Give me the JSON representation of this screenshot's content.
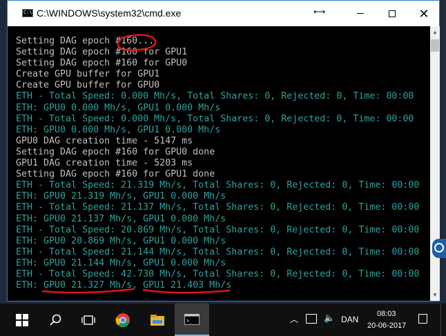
{
  "window": {
    "title": "C:\\WINDOWS\\system32\\cmd.exe",
    "icon_text": "C:\\"
  },
  "console": {
    "lines": [
      {
        "text": "Setting DAG epoch #160...",
        "color": "white"
      },
      {
        "text": "Setting DAG epoch #160 for GPU1",
        "color": "white"
      },
      {
        "text": "Setting DAG epoch #160 for GPU0",
        "color": "white"
      },
      {
        "text": "Create GPU buffer for GPU1",
        "color": "white"
      },
      {
        "text": "Create GPU buffer for GPU0",
        "color": "white"
      },
      {
        "text": "ETH - Total Speed: 0.000 Mh/s, Total Shares: 0, Rejected: 0, Time: 00:00",
        "color": "teal"
      },
      {
        "text": "ETH: GPU0 0.000 Mh/s, GPU1 0.000 Mh/s",
        "color": "teal"
      },
      {
        "text": "ETH - Total Speed: 0.000 Mh/s, Total Shares: 0, Rejected: 0, Time: 00:00",
        "color": "teal"
      },
      {
        "text": "ETH: GPU0 0.000 Mh/s, GPU1 0.000 Mh/s",
        "color": "teal"
      },
      {
        "text": "GPU0 DAG creation time - 5147 ms",
        "color": "white"
      },
      {
        "text": "Setting DAG epoch #160 for GPU0 done",
        "color": "white"
      },
      {
        "text": "GPU1 DAG creation time - 5203 ms",
        "color": "white"
      },
      {
        "text": "Setting DAG epoch #160 for GPU1 done",
        "color": "white"
      },
      {
        "text": "ETH - Total Speed: 21.319 Mh/s, Total Shares: 0, Rejected: 0, Time: 00:00",
        "color": "teal"
      },
      {
        "text": "ETH: GPU0 21.319 Mh/s, GPU1 0.000 Mh/s",
        "color": "teal"
      },
      {
        "text": "ETH - Total Speed: 21.137 Mh/s, Total Shares: 0, Rejected: 0, Time: 00:00",
        "color": "teal"
      },
      {
        "text": "ETH: GPU0 21.137 Mh/s, GPU1 0.000 Mh/s",
        "color": "teal"
      },
      {
        "text": "ETH - Total Speed: 20.869 Mh/s, Total Shares: 0, Rejected: 0, Time: 00:00",
        "color": "teal"
      },
      {
        "text": "ETH: GPU0 20.869 Mh/s, GPU1 0.000 Mh/s",
        "color": "teal"
      },
      {
        "text": "ETH - Total Speed: 21.144 Mh/s, Total Shares: 0, Rejected: 0, Time: 00:00",
        "color": "teal"
      },
      {
        "text": "ETH: GPU0 21.144 Mh/s, GPU1 0.000 Mh/s",
        "color": "teal"
      },
      {
        "text": "ETH - Total Speed: 42.730 Mh/s, Total Shares: 0, Rejected: 0, Time: 00:00",
        "color": "teal"
      },
      {
        "text": "ETH: GPU0 21.327 Mh/s, GPU1 21.403 Mh/s",
        "color": "teal"
      }
    ]
  },
  "taskbar": {
    "language": "DAN",
    "time": "08:03",
    "date": "20-06-2017"
  },
  "colors": {
    "console_white": "#c0c0c0",
    "console_teal": "#2fa0a0",
    "annotation_red": "#e0141e",
    "taskbar_bg": "#101010"
  },
  "icons": [
    "cmd-window-icon",
    "move-cursor-icon",
    "minimize-icon",
    "maximize-icon",
    "close-icon",
    "windows-start-icon",
    "search-icon",
    "task-view-icon",
    "chrome-icon",
    "file-explorer-icon",
    "cmd-taskbar-icon",
    "tray-chevron-icon",
    "network-icon",
    "volume-icon",
    "notification-icon"
  ]
}
